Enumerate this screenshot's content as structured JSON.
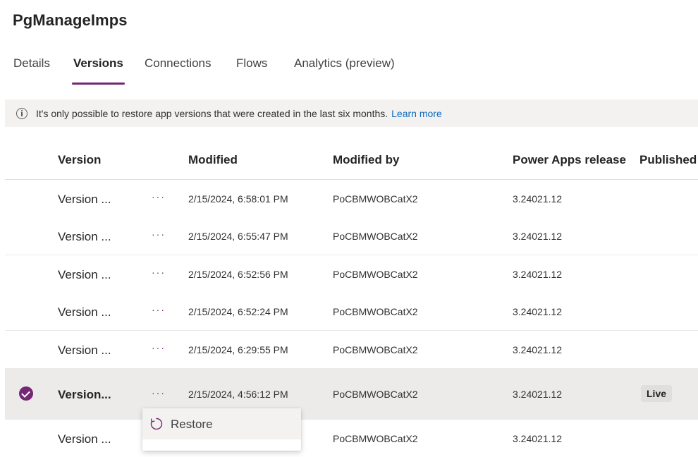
{
  "app": {
    "title": "PgManageImps"
  },
  "tabs": [
    {
      "label": "Details"
    },
    {
      "label": "Versions"
    },
    {
      "label": "Connections"
    },
    {
      "label": "Flows"
    },
    {
      "label": "Analytics (preview)"
    }
  ],
  "active_tab": "Versions",
  "info": {
    "icon": "info-icon",
    "text": "It's only possible to restore app versions that were created in the last six months.",
    "link": "Learn more"
  },
  "table": {
    "headers": {
      "version": "Version",
      "modified": "Modified",
      "modified_by": "Modified by",
      "release": "Power Apps release",
      "published": "Published"
    },
    "more_glyph": "···",
    "rows": [
      {
        "version": "Version ...",
        "modified": "2/15/2024, 6:58:01 PM",
        "modified_by": "PoCBMWOBCatX2",
        "release": "3.24021.12",
        "published": ""
      },
      {
        "version": "Version ...",
        "modified": "2/15/2024, 6:55:47 PM",
        "modified_by": "PoCBMWOBCatX2",
        "release": "3.24021.12",
        "published": ""
      },
      {
        "version": "Version ...",
        "modified": "2/15/2024, 6:52:56 PM",
        "modified_by": "PoCBMWOBCatX2",
        "release": "3.24021.12",
        "published": ""
      },
      {
        "version": "Version ...",
        "modified": "2/15/2024, 6:52:24 PM",
        "modified_by": "PoCBMWOBCatX2",
        "release": "3.24021.12",
        "published": ""
      },
      {
        "version": "Version ...",
        "modified": "2/15/2024, 6:29:55 PM",
        "modified_by": "PoCBMWOBCatX2",
        "release": "3.24021.12",
        "published": ""
      },
      {
        "version": "Version...",
        "modified": "2/15/2024, 4:56:12 PM",
        "modified_by": "PoCBMWOBCatX2",
        "release": "3.24021.12",
        "published": "Live"
      },
      {
        "version": "Version ...",
        "modified": "",
        "modified_by": "PoCBMWOBCatX2",
        "release": "3.24021.12",
        "published": ""
      }
    ]
  },
  "context_menu": {
    "items": [
      {
        "label": "Restore",
        "icon": "restore-icon"
      }
    ]
  },
  "colors": {
    "accent": "#742774",
    "link": "#0f6cbd",
    "info_bg": "#f3f2f1",
    "selected_row_bg": "#edebe9"
  }
}
